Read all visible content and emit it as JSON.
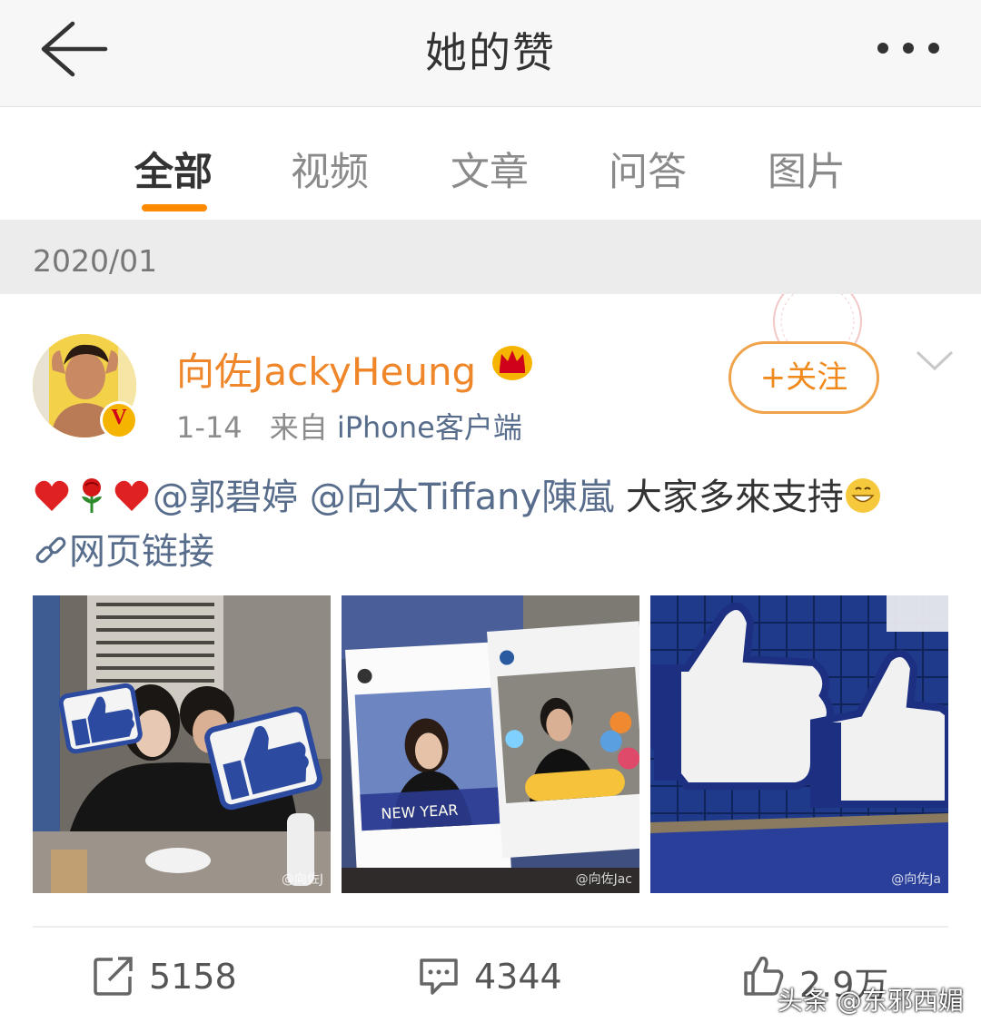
{
  "header": {
    "title": "她的赞"
  },
  "tabs": [
    {
      "label": "全部"
    },
    {
      "label": "视频"
    },
    {
      "label": "文章"
    },
    {
      "label": "问答"
    },
    {
      "label": "图片"
    }
  ],
  "date_group": "2020/01",
  "post": {
    "username": "向佐JackyHeung",
    "time": "1-14",
    "source_prefix": "来自",
    "source": "iPhone客户端",
    "follow_label": "+关注",
    "mention1": "@郭碧婷",
    "mention2": "@向太Tiffany陳嵐",
    "body_text": "大家多來支持",
    "link_label": "网页链接",
    "photos": [
      {
        "alt": "couple-with-like-signs",
        "watermark": "@向佐J"
      },
      {
        "alt": "obba-bar-photo-frames",
        "watermark": "@向佐Jac"
      },
      {
        "alt": "obba-bar-thumbs-up-signs",
        "watermark": "@向佐Ja"
      }
    ],
    "stats": {
      "reposts": "5158",
      "comments": "4344",
      "likes": "2.9万"
    }
  },
  "watermark": "头条 @东邪西媚",
  "colors": {
    "accent": "#ff8a00",
    "username": "#f0862a",
    "link": "#586d8c"
  }
}
